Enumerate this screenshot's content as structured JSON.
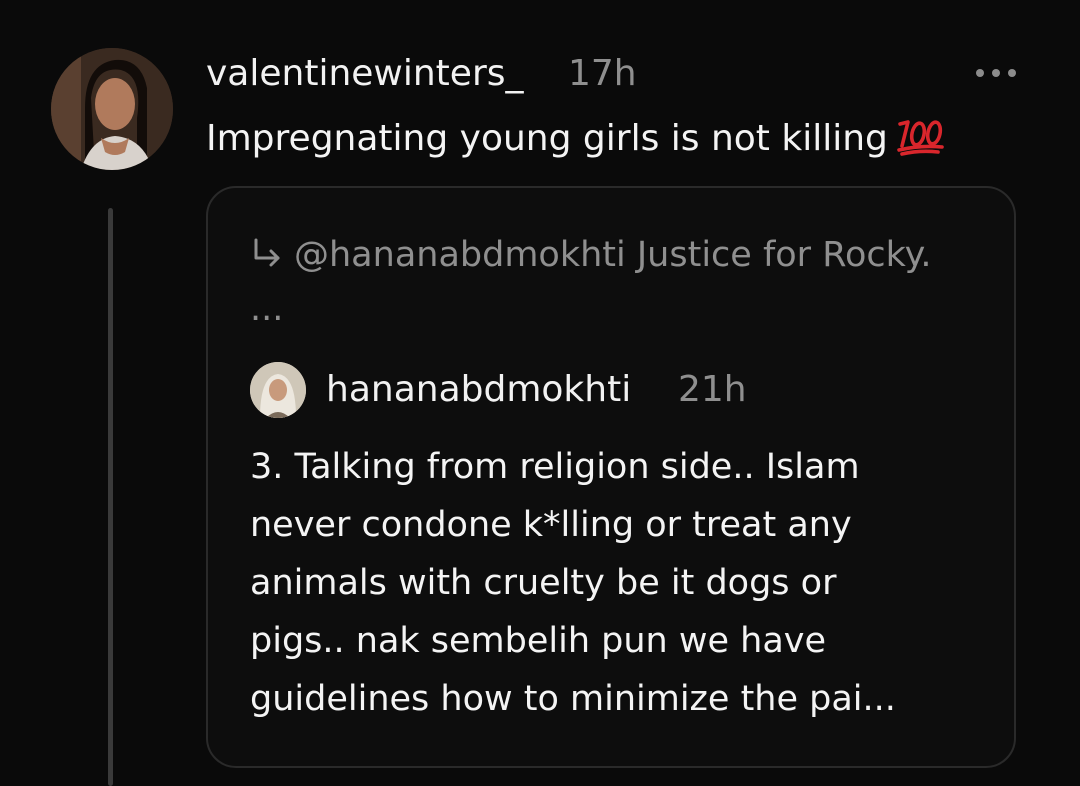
{
  "post": {
    "username": "valentinewinters_",
    "time": "17h",
    "text": "Impregnating young girls is not killing",
    "emoji_icon": "hundred-points-icon",
    "more_icon": "more-options-icon"
  },
  "quote": {
    "reply_icon": "reply-arrow-icon",
    "reply_context": "@hananabdmokhti Justice for Rocky. ...",
    "username": "hananabdmokhti",
    "time": "21h",
    "text_lines": [
      "3. Talking from religion side.. Islam",
      "never condone k*lling or treat any",
      "animals with cruelty be it dogs or",
      "pigs.. nak sembelih pun we have",
      "guidelines how to minimize the pai..."
    ]
  },
  "colors": {
    "background": "#0a0a0a",
    "text_primary": "#f2f2f2",
    "text_secondary": "#8f8f8f",
    "emoji_red": "#d9262c",
    "border": "#2a2a2a"
  }
}
